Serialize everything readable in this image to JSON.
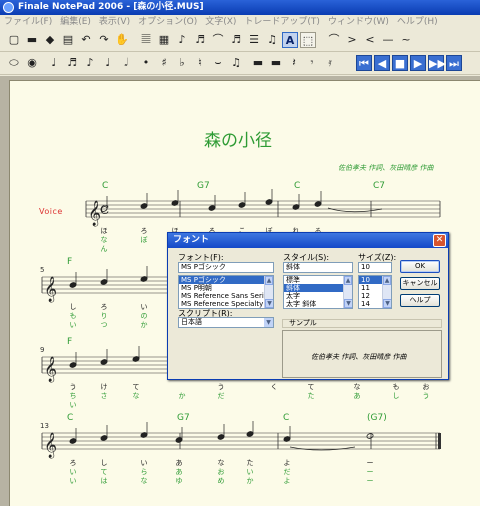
{
  "window": {
    "title": "Finale NotePad 2006 - [森の小径.MUS]"
  },
  "menu": [
    "ファイル(F)",
    "編集(E)",
    "表示(V)",
    "オプション(O)",
    "文字(X)",
    "トレードアップ(T)",
    "ウィンドウ(W)",
    "ヘルプ(H)"
  ],
  "toolbar1": [
    {
      "icon": "new-doc-icon",
      "glyph": "▢"
    },
    {
      "icon": "open-icon",
      "glyph": "▬"
    },
    {
      "icon": "eraser-icon",
      "glyph": "◆"
    },
    {
      "icon": "print-icon",
      "glyph": "▤"
    },
    {
      "icon": "undo-icon",
      "glyph": "↶"
    },
    {
      "icon": "redo-icon",
      "glyph": "↷"
    },
    {
      "icon": "hand-icon",
      "glyph": "✋"
    },
    {
      "icon": "staff-tool-icon",
      "glyph": "𝄚"
    },
    {
      "icon": "measure-tool-icon",
      "glyph": "▦"
    },
    {
      "icon": "note-tool-icon",
      "glyph": "♪"
    },
    {
      "icon": "chord-tool-icon",
      "glyph": "♬"
    },
    {
      "icon": "slur-tool-icon",
      "glyph": "⌒"
    },
    {
      "icon": "tuplet-tool-icon",
      "glyph": "♬"
    },
    {
      "icon": "repeat-tool-icon",
      "glyph": "☰"
    },
    {
      "icon": "lyrics-tool-icon",
      "glyph": "♫"
    },
    {
      "icon": "text-tool-icon",
      "glyph": "A"
    },
    {
      "icon": "selection-tool-icon",
      "glyph": "⬚"
    },
    {
      "icon": "slur-shape-icon",
      "glyph": "⌒"
    },
    {
      "icon": "crescendo-icon",
      "glyph": ">"
    },
    {
      "icon": "decrescendo-icon",
      "glyph": "<"
    },
    {
      "icon": "line-icon",
      "glyph": "—"
    },
    {
      "icon": "tilde-icon",
      "glyph": "~"
    }
  ],
  "toolbar2": [
    {
      "icon": "simple-entry-icon",
      "glyph": "⬭"
    },
    {
      "icon": "eye-icon",
      "glyph": "◉"
    },
    {
      "icon": "thirtysecond-note-icon",
      "glyph": "♩"
    },
    {
      "icon": "sixteenth-note-icon",
      "glyph": "♬"
    },
    {
      "icon": "eighth-note-icon",
      "glyph": "♪"
    },
    {
      "icon": "quarter-note-icon",
      "glyph": "♩"
    },
    {
      "icon": "half-note-icon",
      "glyph": "𝅗𝅥"
    },
    {
      "icon": "dot-icon",
      "glyph": "•"
    },
    {
      "icon": "sharp-icon",
      "glyph": "♯"
    },
    {
      "icon": "flat-icon",
      "glyph": "♭"
    },
    {
      "icon": "natural-icon",
      "glyph": "♮"
    },
    {
      "icon": "tie-icon",
      "glyph": "⌣"
    },
    {
      "icon": "beam-icon",
      "glyph": "♫"
    },
    {
      "icon": "whole-rest-icon",
      "glyph": "▬"
    },
    {
      "icon": "half-rest-icon",
      "glyph": "▬"
    },
    {
      "icon": "quarter-rest-icon",
      "glyph": "𝄽"
    },
    {
      "icon": "eighth-rest-icon",
      "glyph": "𝄾"
    },
    {
      "icon": "sixteenth-rest-icon",
      "glyph": "𝄿"
    },
    {
      "icon": "rewind-start-icon",
      "glyph": "⏮"
    },
    {
      "icon": "rewind-icon",
      "glyph": "◀"
    },
    {
      "icon": "stop-icon",
      "glyph": "■"
    },
    {
      "icon": "play-icon",
      "glyph": "▶"
    },
    {
      "icon": "forward-icon",
      "glyph": "▶▶"
    },
    {
      "icon": "forward-end-icon",
      "glyph": "⏭"
    }
  ],
  "score": {
    "title": "森の小径",
    "composer": "佐伯孝夫 作詞、灰田晴彦 作曲",
    "voice_label": "Voice",
    "systems": [
      {
        "measure_number": "",
        "chords": [
          "C",
          "G7",
          "C",
          "C7"
        ],
        "lyrics1": [
          "ほ",
          "ろ",
          "ほ",
          "ろ",
          "こ",
          "ぼ",
          "れ",
          "る"
        ],
        "lyrics2": [
          "なん",
          "ぼ",
          "に",
          "",
          "",
          "",
          "",
          ""
        ]
      },
      {
        "measure_number": "5",
        "chords": [
          "F",
          "",
          "",
          ""
        ],
        "lyrics1": [
          "し",
          "ろ",
          "い",
          "",
          "",
          "",
          "",
          ""
        ],
        "lyrics2": [
          "も",
          "り",
          "の",
          "",
          "",
          "",
          "",
          ""
        ],
        "lyrics3": [
          "い",
          "つ",
          "か",
          "",
          "",
          "",
          "",
          ""
        ]
      },
      {
        "measure_number": "9",
        "chords": [
          "F",
          "",
          "",
          ""
        ],
        "lyrics1": [
          "う",
          "け",
          "て",
          "",
          "",
          "",
          "",
          ""
        ],
        "lyrics2": [
          "ちい",
          "さ",
          "な",
          "か",
          "",
          "",
          "",
          ""
        ],
        "lyrics3": [
          "",
          "",
          "",
          "",
          "",
          "",
          "",
          ""
        ],
        "lyrics_right": [
          "う",
          "く",
          "て",
          "な",
          "も",
          "お"
        ],
        "lyrics_right2": [
          "だ",
          "",
          "た",
          "あ",
          "し",
          "う"
        ]
      },
      {
        "measure_number": "13",
        "chords": [
          "C",
          "G7",
          "C",
          "(G7)"
        ],
        "lyrics1": [
          "ろ",
          "し",
          "い",
          "あ",
          "な",
          "た",
          "よ",
          "ー"
        ],
        "lyrics2": [
          "い",
          "て",
          "ら",
          "あ",
          "お",
          "い",
          "だ",
          "ー"
        ],
        "lyrics3": [
          "い",
          "は",
          "な",
          "ゆ",
          "め",
          "か",
          "よ",
          "ー"
        ]
      }
    ]
  },
  "dialog": {
    "title": "フォント",
    "font_label": "フォント(F):",
    "font_value": "MS Pゴシック",
    "font_list": [
      "MS Pゴシック",
      "MS P明朝",
      "MS Reference Sans Serif",
      "MS Reference Specialty"
    ],
    "font_selected": 0,
    "style_label": "スタイル(S):",
    "style_value": "斜体",
    "style_list": [
      "標準",
      "斜体",
      "太字",
      "太字 斜体"
    ],
    "style_selected": 1,
    "size_label": "サイズ(Z):",
    "size_value": "10",
    "size_list": [
      "10",
      "11",
      "12",
      "14"
    ],
    "size_selected": 0,
    "ok_label": "OK",
    "cancel_label": "キャンセル",
    "help_label": "ヘルプ",
    "script_label": "スクリプト(R):",
    "script_value": "日本語",
    "sample_label": "サンプル",
    "sample_text": "佐伯孝夫 作詞、灰田晴彦 作曲"
  }
}
